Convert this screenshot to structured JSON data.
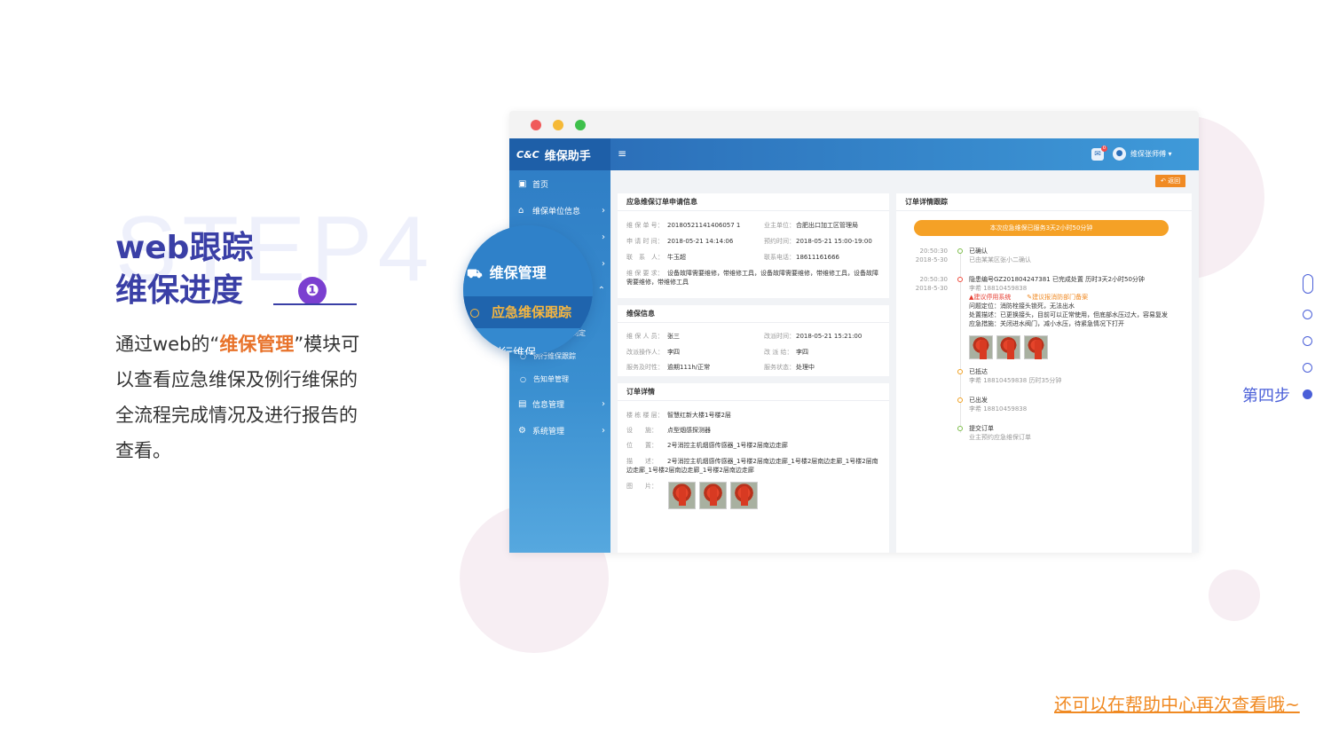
{
  "left": {
    "watermark": "STEP4",
    "title_line1": "web跟踪",
    "title_line2": "维保进度",
    "step_number": "❶",
    "desc_before": "通过web的“",
    "desc_highlight": "维保管理",
    "desc_after": "”模块可以查看应急维保及例行维保的全流程完成情况及进行报告的查看。"
  },
  "app": {
    "brand_logo": "C&C",
    "brand_name": "维保助手",
    "menu_toggle": "≡",
    "msg_badge": "0",
    "user_name": "维保张师傅 ▾",
    "back_button": "↶ 返回",
    "sidebar": [
      {
        "icon": "▣",
        "label": "首页"
      },
      {
        "icon": "⌂",
        "label": "维保单位信息",
        "chev": "›"
      },
      {
        "icon": "▤",
        "label": "",
        "chev": "›"
      },
      {
        "icon": "▤",
        "label": "",
        "chev": "›"
      },
      {
        "icon": "▤",
        "label": "",
        "chev": "⌃"
      }
    ],
    "sidebar_sub": [
      {
        "icon": "○",
        "label": "制定"
      },
      {
        "icon": "○",
        "label": "例行维保跟踪"
      },
      {
        "icon": "○",
        "label": "告知单管理"
      }
    ],
    "sidebar_bottom": [
      {
        "icon": "▤",
        "label": "信息管理",
        "chev": "›"
      },
      {
        "icon": "⚙",
        "label": "系统管理",
        "chev": "›"
      }
    ]
  },
  "order_info": {
    "title": "应急维保订单申请信息",
    "no_label": "维 保 单 号：",
    "no": "20180521141406057 1",
    "unit_label": "业主单位：",
    "unit": "合肥出口加工区管理局",
    "apply_time_label": "申 请 时 间：",
    "apply_time": "2018-05-21 14:14:06",
    "book_time_label": "预约时间：",
    "book_time": "2018-05-21 15:00-19:00",
    "contact_label": "联　系　人：",
    "contact": "牛玉超",
    "phone_label": "联系电话：",
    "phone": "18611161666",
    "req_label": "维 保 要 求：",
    "req": "设备故障需要维修，带维修工具，设备故障需要维修，带维修工具，设备故障需要维修，带维修工具"
  },
  "maint_info": {
    "title": "维保信息",
    "person_label": "维 保 人 员：",
    "person": "张三",
    "change_time_label": "改派时间：",
    "change_time": "2018-05-21 15:21:00",
    "operator_label": "改派操作人：",
    "operator": "李四",
    "changed_to_label": "改 派 给：",
    "changed_to": "李四",
    "timely_label": "服务及时性：",
    "timely": "逾期111h/正常",
    "status_label": "服务状态：",
    "status": "处理中"
  },
  "order_detail": {
    "title": "订单详情",
    "floor_label": "楼 栋 楼 层：",
    "floor": "智慧红新大楼1号楼2层",
    "device_label": "设　　施：",
    "device": "点型烟感探测器",
    "pos_label": "位　　置：",
    "pos": "2号消控主机烟感传感器_1号楼2层南边走廊",
    "desc_label": "描　　述：",
    "desc": "2号消控主机烟感传感器_1号楼2层南边走廊_1号楼2层南边走廊_1号楼2层南边走廊_1号楼2层南边走廊_1号楼2层南边走廊",
    "photo_label": "图　　片："
  },
  "tracking": {
    "title": "订单详情跟踪",
    "summary": "本次应急维保已服务3天2小时50分钟",
    "events": [
      {
        "time": "20:50:30",
        "date": "2018-5-30",
        "title": "已确认",
        "sub": "已由某某区张小二确认"
      },
      {
        "time": "20:50:30",
        "date": "2018-5-30",
        "title": "隐患编号GZ201804247381  已完成处置  历时3天2小时50分钟",
        "sub": "李希 18810459838",
        "warn": "▲建议停用系统",
        "tip": "✎建议报消防部门备案",
        "l1": "问题定位：消防栓接头锁死，无法出水",
        "l2": "处置描述：已更换接头，目前可以正常使用，但底部水压过大，容易复发",
        "l3": "应急措施：关闭进水阀门，减小水压，待紧急情况下打开"
      },
      {
        "time": "",
        "date": "",
        "title": "已抵达",
        "sub": "李希 18810459838  历时35分钟"
      },
      {
        "time": "",
        "date": "",
        "title": "已出发",
        "sub": "李希 18810459838"
      },
      {
        "time": "",
        "date": "",
        "title": "提交订单",
        "sub": "业主预约应急维保订单"
      }
    ]
  },
  "magnifier": {
    "row1_icon": "⛟",
    "row1": "维保管理",
    "row2": "应急维保跟踪",
    "row3": "例行维保"
  },
  "steps": {
    "current_label": "第四步"
  },
  "help_link": "还可以在帮助中心再次查看哦~",
  "colors": {
    "title": "#3a3fa6",
    "highlight": "#e8722a",
    "sidebar": "#2e7cc4",
    "accent_orange": "#f5a126",
    "step_blue": "#4a5fd8"
  }
}
